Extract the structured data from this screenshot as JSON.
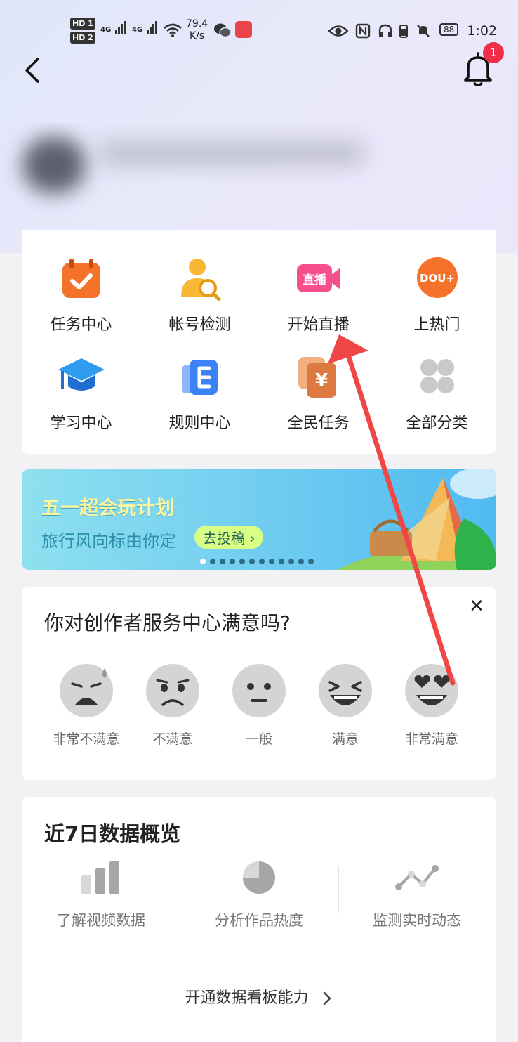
{
  "status_bar": {
    "hd1": "HD 1",
    "hd2": "HD 2",
    "sig1": "4G",
    "sig2": "4G",
    "speed_value": "79.4",
    "speed_unit": "K/s",
    "battery": "88",
    "time": "1:02"
  },
  "header": {
    "notification_count": "1"
  },
  "grid": {
    "items": [
      {
        "label": "任务中心"
      },
      {
        "label": "帐号检测"
      },
      {
        "label": "开始直播",
        "icon_text": "直播"
      },
      {
        "label": "上热门",
        "icon_text": "DOU+"
      },
      {
        "label": "学习中心"
      },
      {
        "label": "规则中心"
      },
      {
        "label": "全民任务"
      },
      {
        "label": "全部分类"
      }
    ]
  },
  "banner": {
    "title": "五一超会玩计划",
    "subtitle": "旅行风向标由你定",
    "button": "去投稿 ›"
  },
  "survey": {
    "title": "你对创作者服务中心满意吗?",
    "options": [
      "非常不满意",
      "不满意",
      "一般",
      "满意",
      "非常满意"
    ]
  },
  "overview": {
    "title": "近7日数据概览",
    "items": [
      "了解视频数据",
      "分析作品热度",
      "监测实时动态"
    ],
    "link": "开通数据看板能力"
  },
  "colors": {
    "accent_red": "#ef2f4a",
    "annotation_arrow": "#f04646",
    "orange_icon": "#f5722a",
    "blue_icon": "#3b82f6"
  }
}
